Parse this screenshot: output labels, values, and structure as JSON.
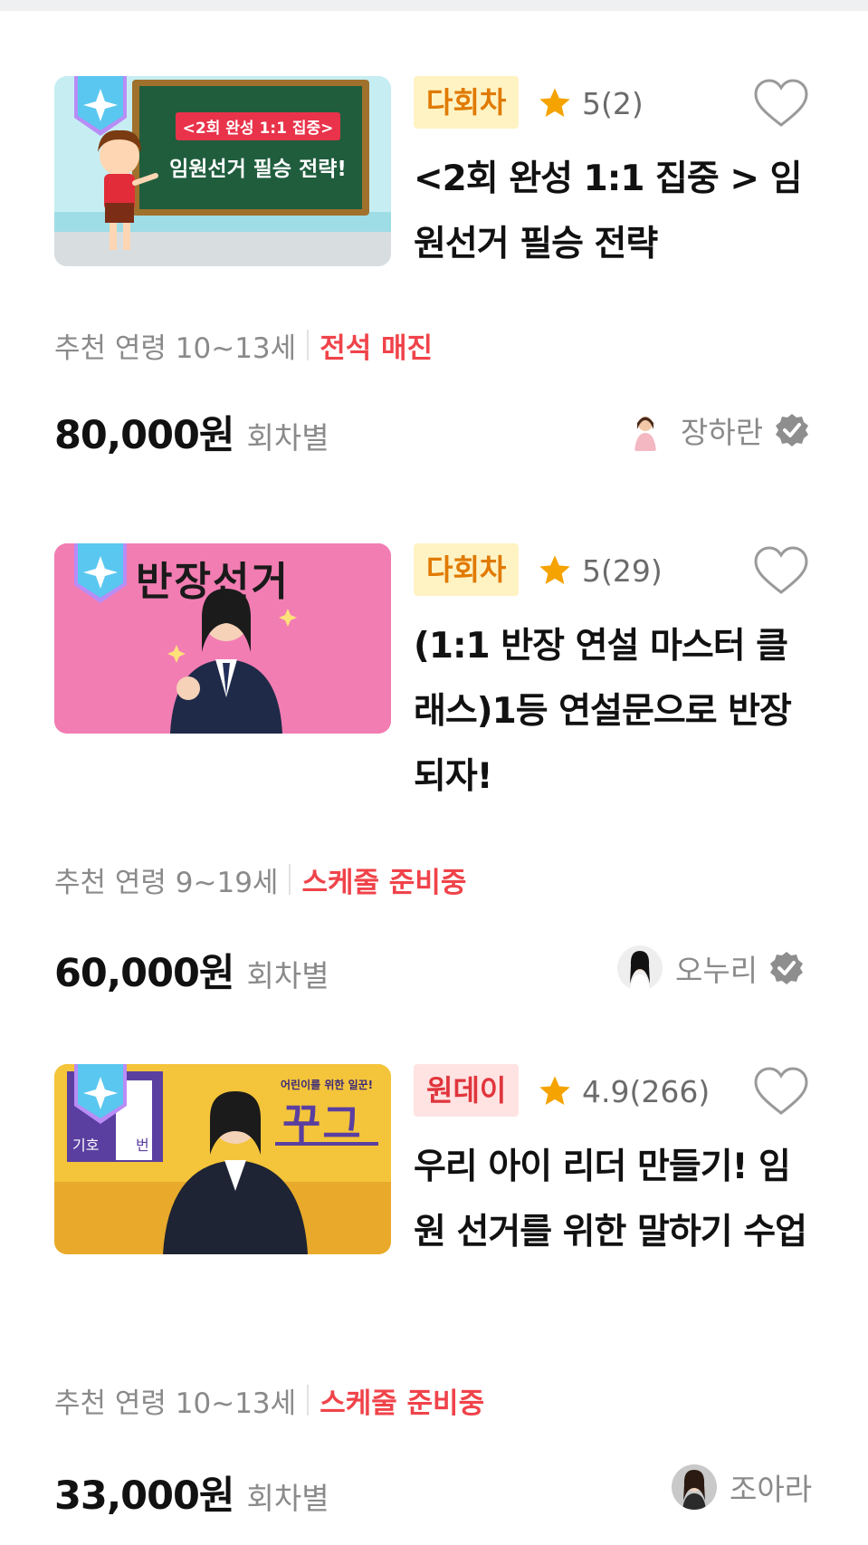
{
  "courses": [
    {
      "thumb_text": {
        "line1": "<2회 완성 1:1 집중>",
        "line2": "임원선거 필승 전략!"
      },
      "tag": "다회차",
      "rating": "5(2)",
      "title": "<2회 완성 1:1 집중 > 임원선거 필승 전략",
      "age": "추천 연령 10~13세",
      "status": "전석 매진",
      "price": "80,000원",
      "price_unit": "회차별",
      "teacher": "장하란",
      "verified": true
    },
    {
      "thumb_text": {
        "line1": "반장선거"
      },
      "tag": "다회차",
      "rating": "5(29)",
      "title": "(1:1 반장 연설 마스터 클래스)1등 연설문으로 반장 되자!",
      "age": "추천 연령 9~19세",
      "status": "스케줄 준비중",
      "price": "60,000원",
      "price_unit": "회차별",
      "teacher": "오누리",
      "verified": true
    },
    {
      "thumb_text": {
        "small": "어린이를 위한 일꾼!",
        "big": "꾸그",
        "left1": "기호",
        "left2": "번"
      },
      "tag": "원데이",
      "rating": "4.9(266)",
      "title": "우리 아이 리더 만들기! 임원 선거를 위한 말하기 수업",
      "age": "추천 연령 10~13세",
      "status": "스케줄 준비중",
      "price": "33,000원",
      "price_unit": "회차별",
      "teacher": "조아라",
      "verified": false
    }
  ],
  "colors": {
    "star": "#f5a300",
    "status_red": "#f0434a",
    "tag_multi_bg": "#fff3c4",
    "tag_oneday_bg": "#ffe3e3"
  }
}
